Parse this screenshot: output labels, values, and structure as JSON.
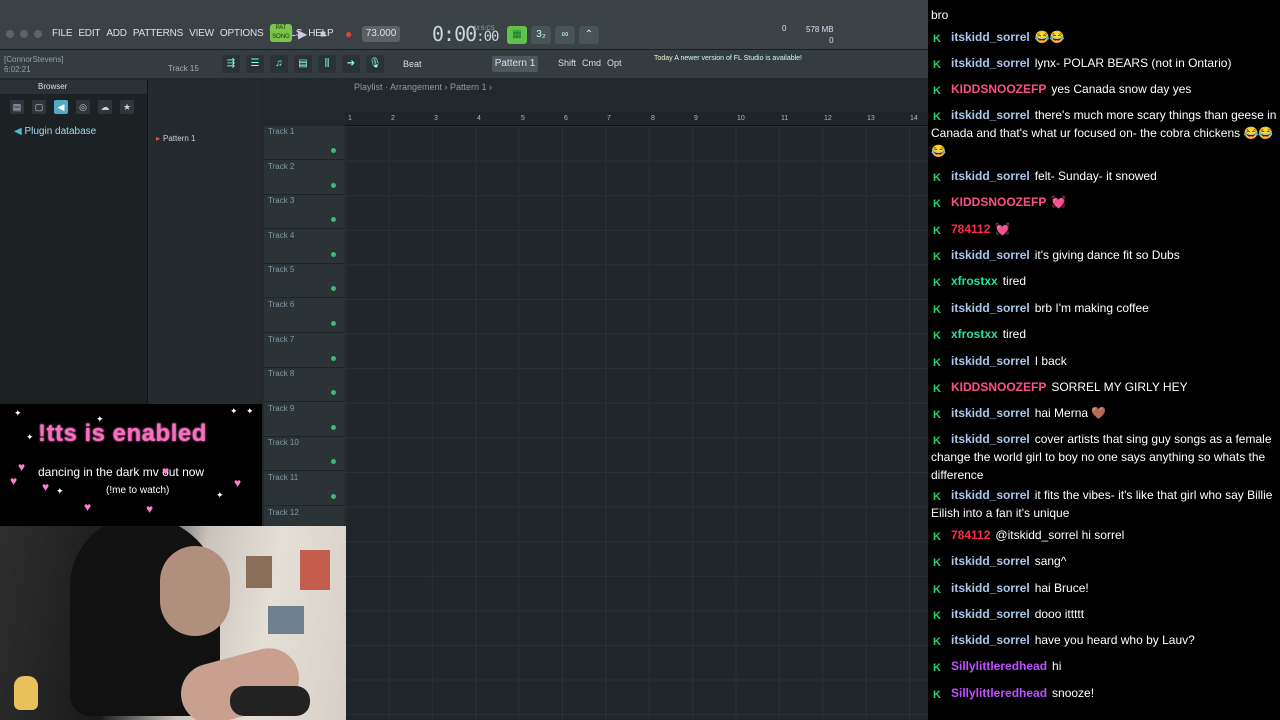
{
  "fl": {
    "menus": [
      "FILE",
      "EDIT",
      "ADD",
      "PATTERNS",
      "VIEW",
      "OPTIONS",
      "TOOLS",
      "HELP"
    ],
    "pat_label": "PAT SONG",
    "tempo": "73.000",
    "time": "0:00",
    "time_frames": ":00",
    "time_unit": "M:S:CS",
    "cpu": "0",
    "mem": "578 MB",
    "mem2": "0",
    "user": "[ConnorStevens]",
    "user_time": "6:02:21",
    "track_hint": "Track 15",
    "beat_mode": "Beat",
    "pattern_selector": "Pattern 1",
    "kbd": [
      "Shift",
      "Cmd",
      "Opt"
    ],
    "news_title": "Today",
    "news_text": "A newer version of FL Studio is available!",
    "browser_title": "Browser",
    "plugin_db": "Plugin database",
    "pattern_list": [
      "Pattern 1"
    ],
    "playlist_breadcrumb": "Playlist · Arrangement › Pattern 1 ›",
    "ruler": [
      "1",
      "2",
      "3",
      "4",
      "5",
      "6",
      "7",
      "8",
      "9",
      "10",
      "11",
      "12",
      "13",
      "14"
    ],
    "tracks": [
      "Track 1",
      "Track 2",
      "Track 3",
      "Track 4",
      "Track 5",
      "Track 6",
      "Track 7",
      "Track 8",
      "Track 9",
      "Track 10",
      "Track 11",
      "Track 12"
    ]
  },
  "overlay": {
    "tts_title": "!tts is enabled",
    "tts_line1": "dancing in the dark mv out now",
    "tts_line2": "(!me to watch)"
  },
  "chat": {
    "top_text": "bro",
    "colors": {
      "blue": "#a9c8ec",
      "pink": "#ff4f87",
      "red": "#ff2a4c",
      "teal": "#26e0a8",
      "purple": "#c04fff"
    },
    "messages": [
      {
        "user": "itskidd_sorrel",
        "color": "blue",
        "text": "😂😂"
      },
      {
        "user": "itskidd_sorrel",
        "color": "blue",
        "text": "lynx- POLAR BEARS (not in Ontario)"
      },
      {
        "user": "KIDDSNOOZEFP",
        "color": "pink",
        "text": "yes Canada snow day yes"
      },
      {
        "user": "itskidd_sorrel",
        "color": "blue",
        "text": "there's much more scary things than geese in Canada and that's what ur focused on- the cobra chickens 😂😂😂"
      },
      {
        "user": "itskidd_sorrel",
        "color": "blue",
        "text": "felt- Sunday- it snowed"
      },
      {
        "user": "KIDDSNOOZEFP",
        "color": "pink",
        "text": "💓"
      },
      {
        "user": "784112",
        "color": "red",
        "text": "💓"
      },
      {
        "user": "itskidd_sorrel",
        "color": "blue",
        "text": "it's giving dance fit so Dubs"
      },
      {
        "user": "xfrostxx",
        "color": "teal",
        "text": "tired"
      },
      {
        "user": "itskidd_sorrel",
        "color": "blue",
        "text": "brb I'm making coffee"
      },
      {
        "user": "xfrostxx",
        "color": "teal",
        "text": "tired"
      },
      {
        "user": "itskidd_sorrel",
        "color": "blue",
        "text": "I back"
      },
      {
        "user": "KIDDSNOOZEFP",
        "color": "pink",
        "text": "SORREL MY GIRLY HEY"
      },
      {
        "user": "itskidd_sorrel",
        "color": "blue",
        "text": "hai Merna 🤎"
      },
      {
        "user": "itskidd_sorrel",
        "color": "blue",
        "text": "cover artists that sing guy songs as a female change the world girl to boy no one says anything so whats the difference"
      },
      {
        "user": "itskidd_sorrel",
        "color": "blue",
        "text": "it fits the vibes- it's like that girl who say Billie Eilish into a fan it's unique"
      },
      {
        "user": "784112",
        "color": "red",
        "text": "@itskidd_sorrel hi sorrel"
      },
      {
        "user": "itskidd_sorrel",
        "color": "blue",
        "text": "sang^"
      },
      {
        "user": "itskidd_sorrel",
        "color": "blue",
        "text": "hai Bruce!"
      },
      {
        "user": "itskidd_sorrel",
        "color": "blue",
        "text": "dooo ittttt"
      },
      {
        "user": "itskidd_sorrel",
        "color": "blue",
        "text": "have you heard who by Lauv?"
      },
      {
        "user": "Sillylittleredhead",
        "color": "purple",
        "text": "hi"
      },
      {
        "user": "Sillylittleredhead",
        "color": "purple",
        "text": "snooze!"
      }
    ]
  }
}
